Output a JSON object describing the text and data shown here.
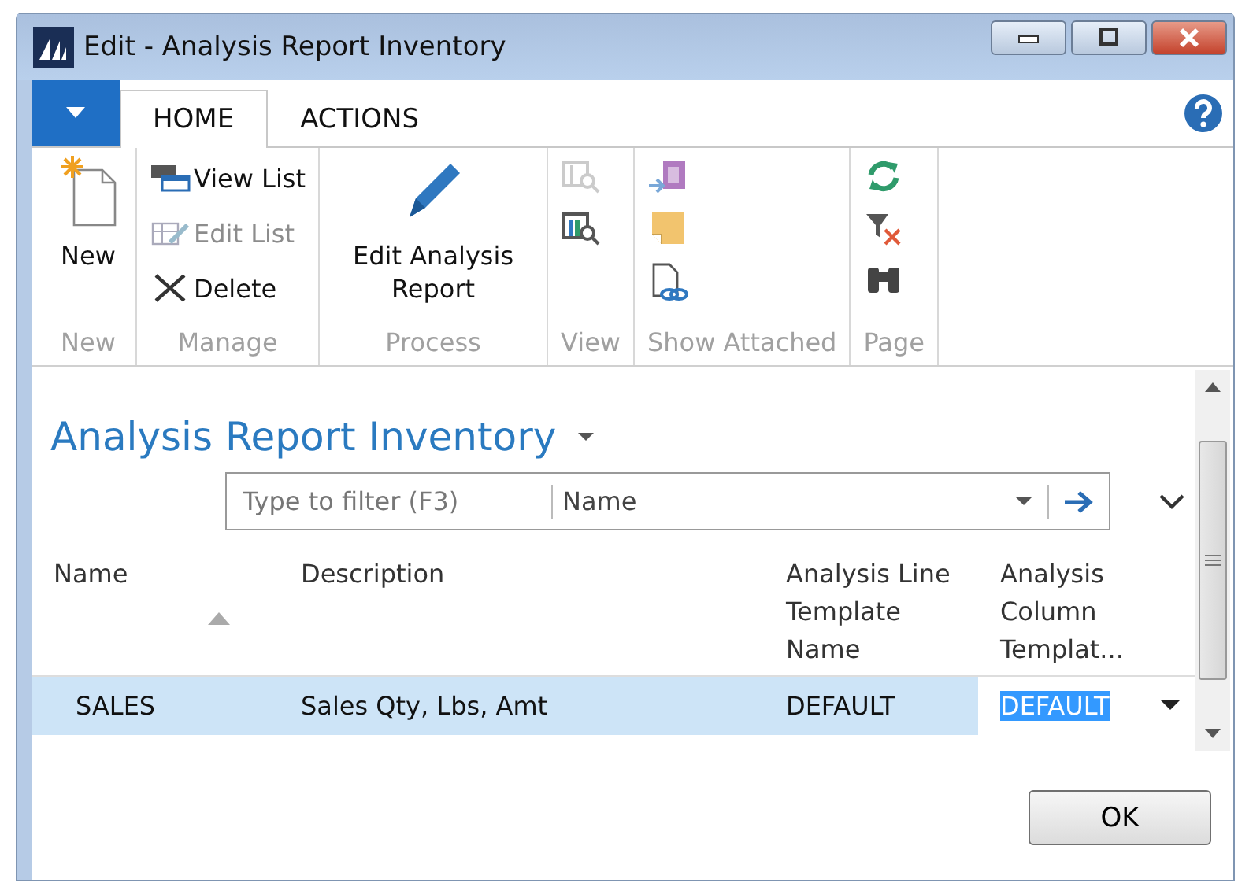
{
  "window": {
    "title": "Edit - Analysis Report Inventory"
  },
  "ribbon": {
    "tabs": [
      {
        "label": "HOME",
        "selected": true
      },
      {
        "label": "ACTIONS",
        "selected": false
      }
    ],
    "groups": [
      {
        "label": "New",
        "items": [
          {
            "kind": "large",
            "label": "New",
            "disabled": false
          }
        ]
      },
      {
        "label": "Manage",
        "items": [
          {
            "kind": "small",
            "label": "View List",
            "disabled": false
          },
          {
            "kind": "small",
            "label": "Edit List",
            "disabled": true
          },
          {
            "kind": "small",
            "label": "Delete",
            "disabled": false
          }
        ]
      },
      {
        "label": "Process",
        "items": [
          {
            "kind": "large",
            "label": "Edit Analysis Report",
            "disabled": false
          }
        ]
      },
      {
        "label": "View",
        "items": [
          {
            "kind": "icon",
            "disabled": true
          },
          {
            "kind": "icon",
            "disabled": false
          }
        ]
      },
      {
        "label": "Show Attached",
        "items": [
          {
            "kind": "icon",
            "disabled": false
          },
          {
            "kind": "icon",
            "disabled": false
          },
          {
            "kind": "icon",
            "disabled": false
          }
        ]
      },
      {
        "label": "Page",
        "items": [
          {
            "kind": "icon",
            "disabled": false
          },
          {
            "kind": "icon",
            "disabled": false
          },
          {
            "kind": "icon",
            "disabled": false
          }
        ]
      }
    ]
  },
  "page": {
    "title": "Analysis Report Inventory",
    "filter": {
      "placeholder": "Type to filter (F3)",
      "field": "Name"
    },
    "table": {
      "columns": [
        {
          "label": "Name",
          "sorted": true
        },
        {
          "label": "Description"
        },
        {
          "label": "Analysis Line Template Name"
        },
        {
          "label": "Analysis Column Templat..."
        }
      ],
      "rows": [
        {
          "selected": true,
          "cells": [
            {
              "text": "SALES",
              "editing": false
            },
            {
              "text": "Sales Qty, Lbs, Amt",
              "editing": false
            },
            {
              "text": "DEFAULT",
              "editing": false
            },
            {
              "text": "DEFAULT",
              "editing": true
            }
          ]
        }
      ]
    }
  },
  "buttons": [
    "OK"
  ]
}
